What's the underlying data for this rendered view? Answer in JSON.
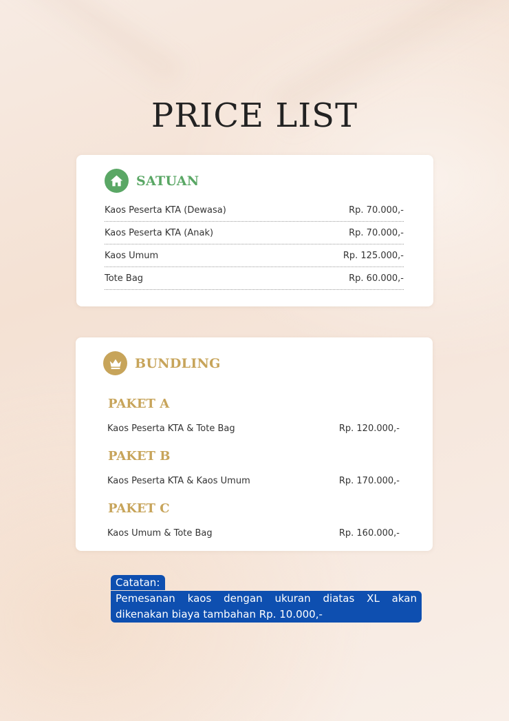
{
  "title": "PRICE LIST",
  "satuan": {
    "heading": "SATUAN",
    "icon": "home-icon",
    "items": [
      {
        "name": "Kaos Peserta KTA (Dewasa)",
        "price": "Rp. 70.000,-"
      },
      {
        "name": "Kaos Peserta KTA (Anak)",
        "price": "Rp. 70.000,-"
      },
      {
        "name": "Kaos Umum",
        "price": "Rp. 125.000,-"
      },
      {
        "name": "Tote Bag",
        "price": "Rp. 60.000,-"
      }
    ]
  },
  "bundling": {
    "heading": "BUNDLING",
    "icon": "crown-icon",
    "packages": [
      {
        "title": "PAKET A",
        "contents": "Kaos Peserta KTA & Tote Bag",
        "price": "Rp. 120.000,-"
      },
      {
        "title": "PAKET B",
        "contents": "Kaos Peserta KTA & Kaos Umum",
        "price": "Rp. 170.000,-"
      },
      {
        "title": "PAKET C",
        "contents": "Kaos Umum & Tote Bag",
        "price": "Rp. 160.000,-"
      }
    ]
  },
  "note": {
    "label": "Catatan:",
    "text": "Pemesanan kaos dengan ukuran diatas XL akan dikenakan biaya tambahan Rp. 10.000,-"
  },
  "colors": {
    "satuan_accent": "#5aa765",
    "bundling_accent": "#c7a45a",
    "note_background": "#0e4fb0"
  }
}
